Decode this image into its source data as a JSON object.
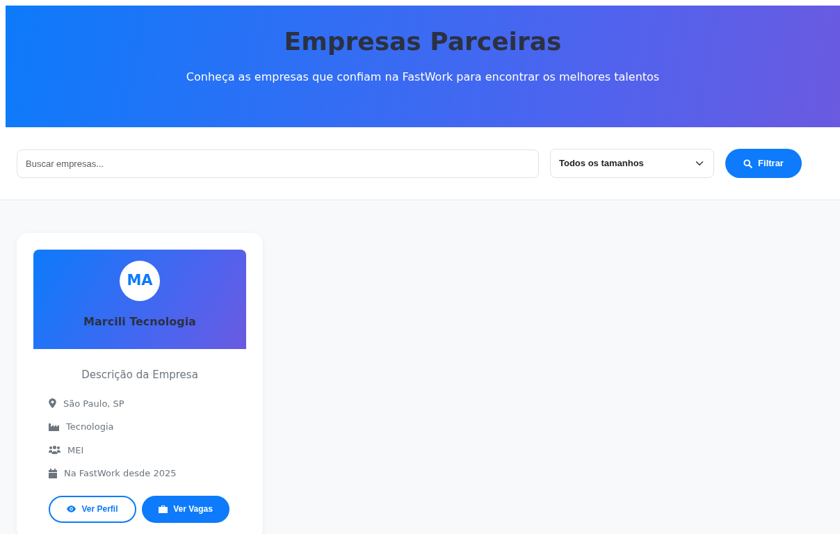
{
  "hero": {
    "title": "Empresas Parceiras",
    "subtitle": "Conheça as empresas que confiam na FastWork para encontrar os melhores talentos"
  },
  "search": {
    "placeholder": "Buscar empresas...",
    "size_select": "Todos os tamanhos",
    "filter_button": "Filtrar"
  },
  "companies": [
    {
      "initials": "MA",
      "name": "Marcili Tecnologia",
      "description": "Descrição da Empresa",
      "details": [
        {
          "kind": "location",
          "text": "São Paulo, SP"
        },
        {
          "kind": "industry",
          "text": "Tecnologia"
        },
        {
          "kind": "size",
          "text": "MEI"
        },
        {
          "kind": "since",
          "text": "Na FastWork desde 2025"
        }
      ],
      "buttons": [
        {
          "kind": "profile",
          "label": "Ver Perfil"
        },
        {
          "kind": "jobs",
          "label": "Ver Vagas"
        }
      ]
    }
  ]
}
